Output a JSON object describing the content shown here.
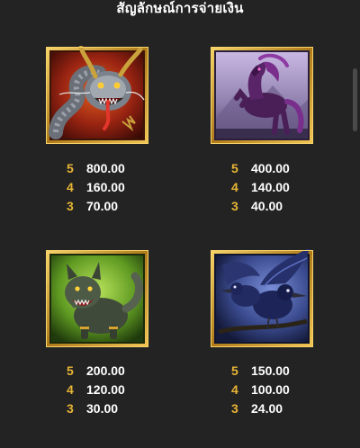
{
  "title": "สัญลักษณ์การจ่ายเงิน",
  "colors": {
    "background": "#232323",
    "count_color": "#e8b535",
    "value_color": "#ffffff",
    "frame_gold": "#d8a431"
  },
  "symbols": [
    {
      "icon": "dragon-icon",
      "payouts": [
        {
          "count": "5",
          "value": "800.00"
        },
        {
          "count": "4",
          "value": "160.00"
        },
        {
          "count": "3",
          "value": "70.00"
        }
      ]
    },
    {
      "icon": "dark-horse-icon",
      "payouts": [
        {
          "count": "5",
          "value": "400.00"
        },
        {
          "count": "4",
          "value": "140.00"
        },
        {
          "count": "3",
          "value": "40.00"
        }
      ]
    },
    {
      "icon": "werewolf-icon",
      "payouts": [
        {
          "count": "5",
          "value": "200.00"
        },
        {
          "count": "4",
          "value": "120.00"
        },
        {
          "count": "3",
          "value": "30.00"
        }
      ]
    },
    {
      "icon": "raven-icon",
      "payouts": [
        {
          "count": "5",
          "value": "150.00"
        },
        {
          "count": "4",
          "value": "100.00"
        },
        {
          "count": "3",
          "value": "24.00"
        }
      ]
    }
  ]
}
